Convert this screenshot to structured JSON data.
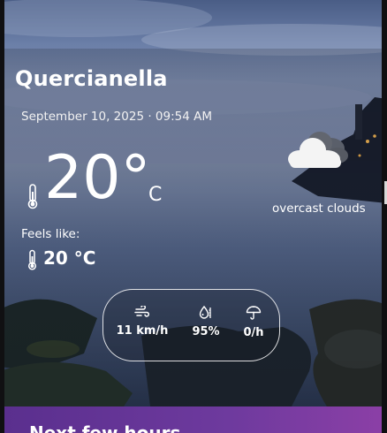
{
  "location": {
    "city": "Quercianella"
  },
  "datetime": "September 10, 2025 · 09:54 AM",
  "current": {
    "temperature": "20°",
    "unit": "C",
    "description": "overcast clouds",
    "feels_like_label": "Feels like:",
    "feels_like_value": "20 °C",
    "icons": {
      "temperature": "thermometer-icon",
      "condition": "overcast-cloud-icon"
    }
  },
  "stats": {
    "wind": {
      "icon": "wind-icon",
      "value": "11 km/h"
    },
    "humidity": {
      "icon": "humidity-icon",
      "value": "95%"
    },
    "precipitation": {
      "icon": "umbrella-icon",
      "value": "0/h"
    }
  },
  "next_hours": {
    "title": "Next few hours"
  },
  "colors": {
    "panel_purple": "#6e3a9e",
    "text": "#ffffff"
  }
}
